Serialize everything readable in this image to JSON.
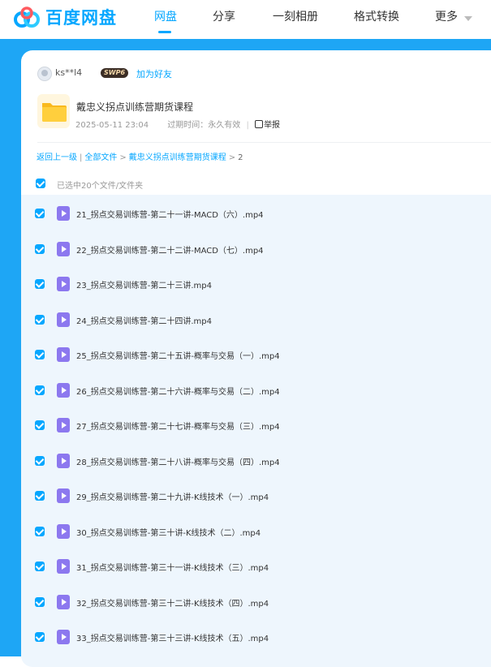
{
  "brand": {
    "name": "百度网盘"
  },
  "nav": {
    "items": [
      "网盘",
      "分享",
      "一刻相册",
      "格式转换",
      "更多"
    ],
    "active_index": 0
  },
  "colors": {
    "accent": "#06a7ff",
    "background": "#1ea6f5",
    "video_icon": "#8c78ef"
  },
  "share": {
    "user": "ks**l4",
    "badge": "SWP6",
    "add_friend": "加为好友",
    "folder_name": "戴忠义拐点训练营期货课程",
    "date": "2025-05-11 23:04",
    "expiry": "过期时间：永久有效",
    "report": "举报"
  },
  "breadcrumb": {
    "back": "返回上一级",
    "all_files": "全部文件",
    "folder": "戴忠义拐点训练营期货课程",
    "current": "2"
  },
  "selection": {
    "text": "已选中20个文件/文件夹",
    "checked": true
  },
  "files": [
    "21_拐点交易训练营-第二十一讲-MACD（六）.mp4",
    "22_拐点交易训练营-第二十二讲-MACD（七）.mp4",
    "23_拐点交易训练营-第二十三讲.mp4",
    "24_拐点交易训练营-第二十四讲.mp4",
    "25_拐点交易训练营-第二十五讲-概率与交易（一）.mp4",
    "26_拐点交易训练营-第二十六讲-概率与交易（二）.mp4",
    "27_拐点交易训练营-第二十七讲-概率与交易（三）.mp4",
    "28_拐点交易训练营-第二十八讲-概率与交易（四）.mp4",
    "29_拐点交易训练营-第二十九讲-K线技术（一）.mp4",
    "30_拐点交易训练营-第三十讲-K线技术（二）.mp4",
    "31_拐点交易训练营-第三十一讲-K线技术（三）.mp4",
    "32_拐点交易训练营-第三十二讲-K线技术（四）.mp4",
    "33_拐点交易训练营-第三十三讲-K线技术（五）.mp4"
  ]
}
